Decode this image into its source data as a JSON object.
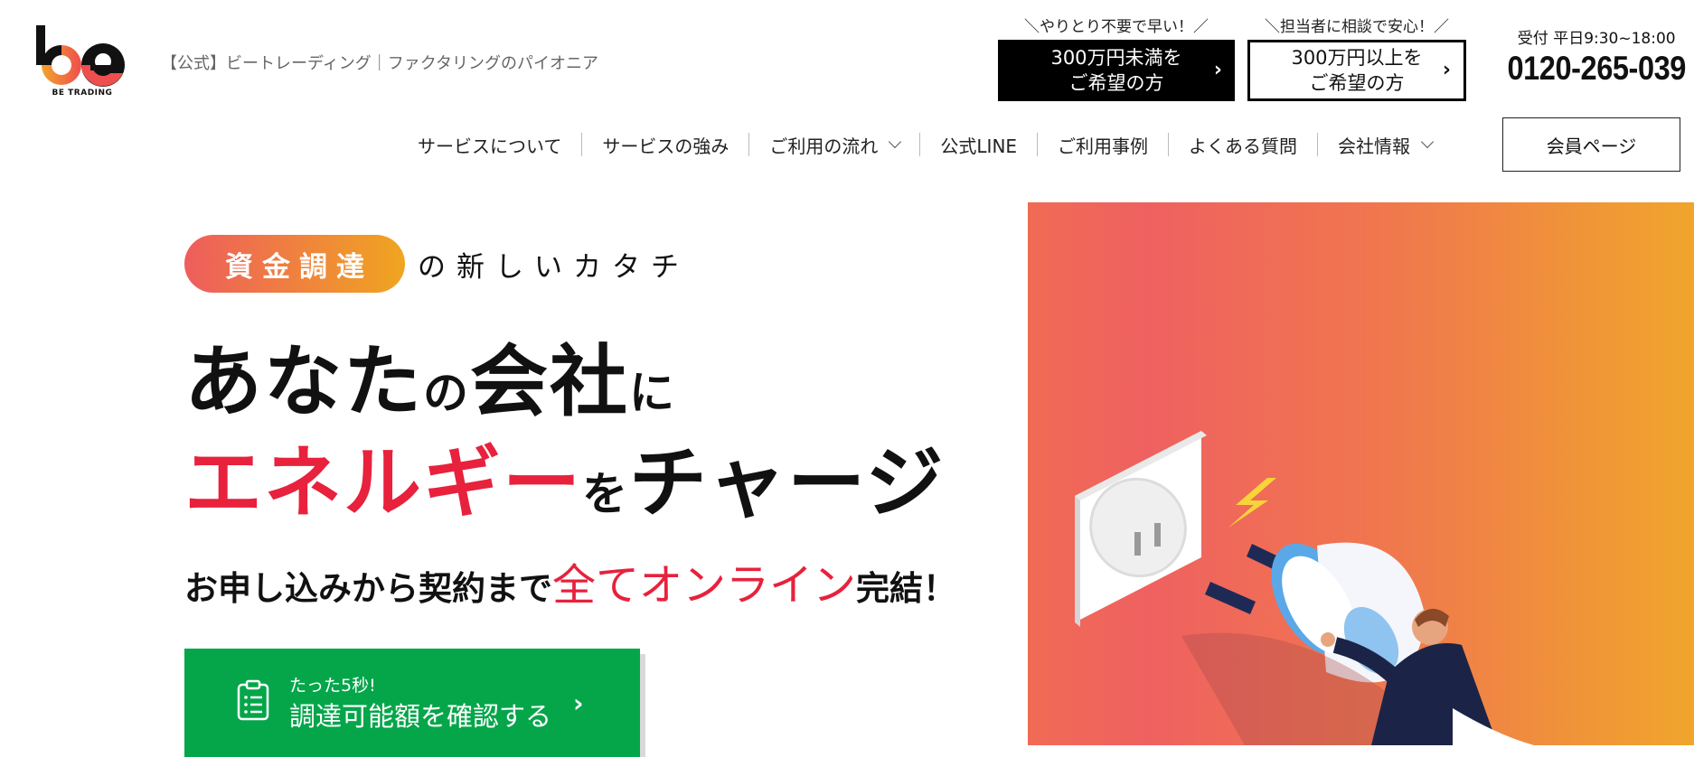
{
  "brand": {
    "logo_text": "BE TRADING",
    "tagline": "【公式】ビートレーディング｜ファクタリングのパイオニア"
  },
  "header": {
    "cta_small": {
      "sub": "＼やりとり不要で早い！／",
      "line1": "300万円未満を",
      "line2": "ご希望の方"
    },
    "cta_large": {
      "sub": "＼担当者に相談で安心！／",
      "line1": "300万円以上を",
      "line2": "ご希望の方"
    },
    "phone": {
      "hours": "受付 平日9:30~18:00",
      "number": "0120-265-039"
    }
  },
  "nav": {
    "items": [
      {
        "label": "サービスについて"
      },
      {
        "label": "サービスの強み"
      },
      {
        "label": "ご利用の流れ"
      },
      {
        "label": "公式LINE"
      },
      {
        "label": "ご利用事例"
      },
      {
        "label": "よくある質問"
      },
      {
        "label": "会社情報"
      }
    ],
    "member_label": "会員ページ"
  },
  "hero": {
    "pill": "資金調達",
    "pill_after": "の新しいカタチ",
    "line1_a": "あなた",
    "line1_b": "の",
    "line1_c": "会社",
    "line1_d": "に",
    "line2_a": "エネルギー",
    "line2_b": "を",
    "line2_c": "チャージ",
    "sub_a": "お申し込みから契約まで",
    "sub_b": "全てオンライン",
    "sub_c": "完結！",
    "cta_small": "たった5秒!",
    "cta_main": "調達可能額を確認する"
  },
  "colors": {
    "accent_red": "#e8213c",
    "cta_green": "#05a64a",
    "gradient_start": "#ef6160",
    "gradient_end": "#f0a52c"
  }
}
